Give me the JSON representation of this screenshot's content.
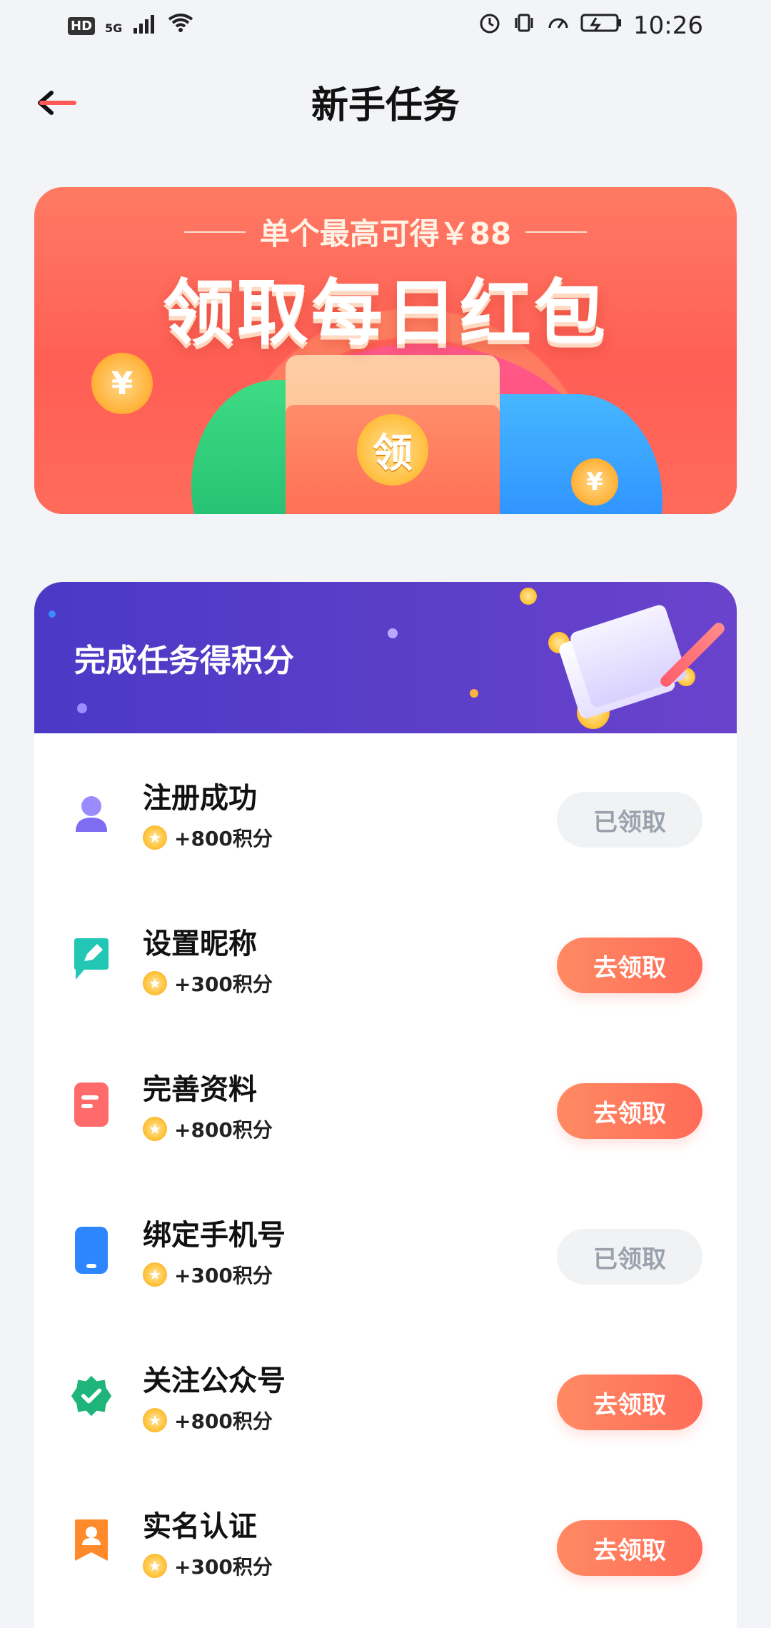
{
  "status_bar": {
    "left": {
      "hd": "HD",
      "network": "5G"
    },
    "time": "10:26"
  },
  "header": {
    "title": "新手任务"
  },
  "banner": {
    "subtitle": "单个最高可得￥88",
    "title": "领取每日红包",
    "coin_text": "领",
    "coin_symbol": "¥"
  },
  "tasks": {
    "section_title": "完成任务得积分",
    "items": [
      {
        "name": "注册成功",
        "points": "+800积分",
        "button": "已领取",
        "status": "claimed",
        "icon": "user-icon"
      },
      {
        "name": "设置昵称",
        "points": "+300积分",
        "button": "去领取",
        "status": "claim",
        "icon": "edit-icon"
      },
      {
        "name": "完善资料",
        "points": "+800积分",
        "button": "去领取",
        "status": "claim",
        "icon": "document-icon"
      },
      {
        "name": "绑定手机号",
        "points": "+300积分",
        "button": "已领取",
        "status": "claimed",
        "icon": "phone-icon"
      },
      {
        "name": "关注公众号",
        "points": "+800积分",
        "button": "去领取",
        "status": "claim",
        "icon": "verified-badge-icon"
      },
      {
        "name": "实名认证",
        "points": "+300积分",
        "button": "去领取",
        "status": "claim",
        "icon": "id-badge-icon"
      }
    ]
  },
  "colors": {
    "accent": "#ff6b58",
    "claimed_bg": "#f1f2f4",
    "claimed_text": "#9aa3ad",
    "section_header": "#5a3ec8"
  }
}
